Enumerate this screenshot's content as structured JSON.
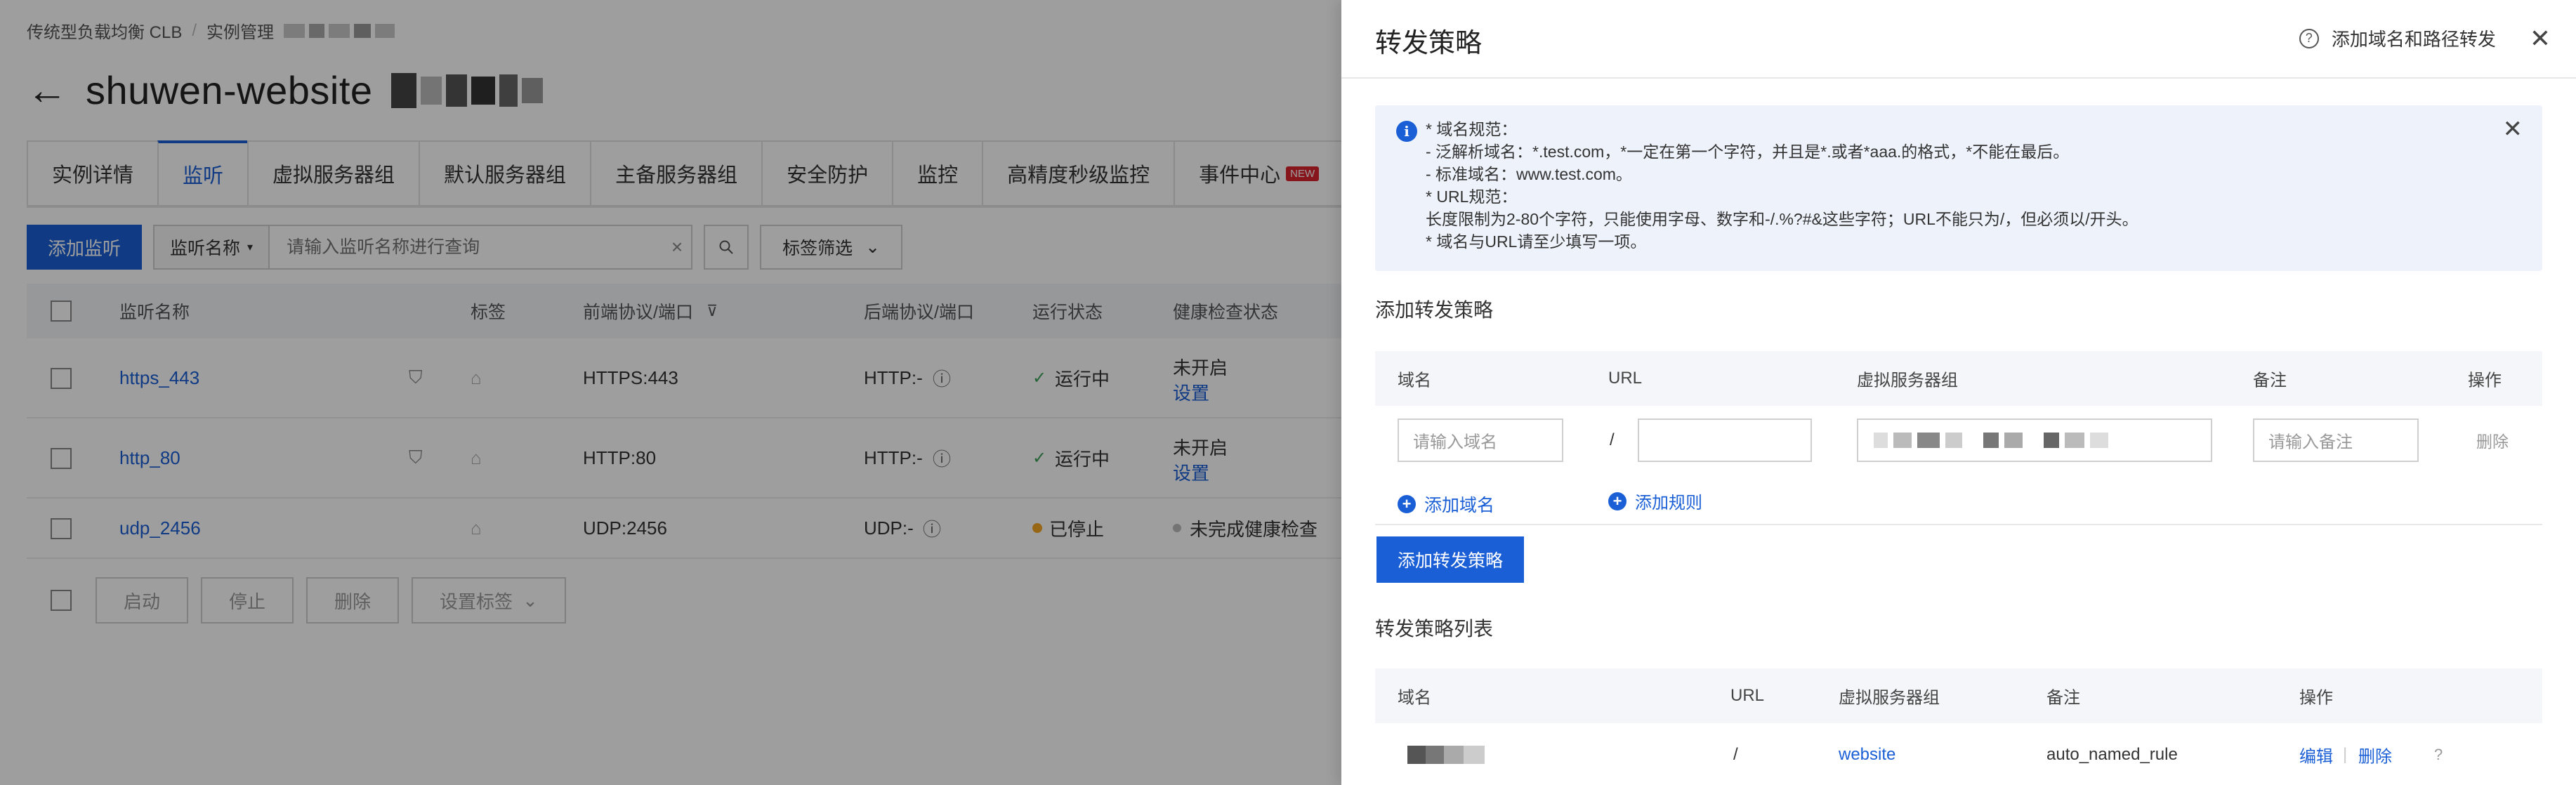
{
  "background": {
    "breadcrumb": [
      "传统型负载均衡 CLB",
      "实例管理"
    ],
    "title": "shuwen-website",
    "tabs": [
      "实例详情",
      "监听",
      "虚拟服务器组",
      "默认服务器组",
      "主备服务器组",
      "安全防护",
      "监控",
      "高精度秒级监控",
      "事件中心"
    ],
    "active_tab": "监听",
    "new_badge": "NEW",
    "toolbar": {
      "add_button": "添加监听",
      "search_select": "监听名称",
      "search_placeholder": "请输入监听名称进行查询",
      "tag_filter": "标签筛选"
    },
    "table": {
      "headers": [
        "监听名称",
        "标签",
        "前端协议/端口",
        "后端协议/端口",
        "运行状态",
        "健康检查状态"
      ],
      "rows": [
        {
          "name": "https_443",
          "frontend": "HTTPS:443",
          "backend": "HTTP:-",
          "status": "运行中",
          "health": "未开启",
          "health_link": "设置"
        },
        {
          "name": "http_80",
          "frontend": "HTTP:80",
          "backend": "HTTP:-",
          "status": "运行中",
          "health": "未开启",
          "health_link": "设置"
        },
        {
          "name": "udp_2456",
          "frontend": "UDP:2456",
          "backend": "UDP:-",
          "status": "已停止",
          "health": "未完成健康检查",
          "health_link": ""
        }
      ]
    },
    "bulk_actions": [
      "启动",
      "停止",
      "删除",
      "设置标签"
    ]
  },
  "drawer": {
    "title": "转发策略",
    "help_link": "添加域名和路径转发",
    "notice": [
      "* 域名规范：",
      "- 泛解析域名：*.test.com，*一定在第一个字符，并且是*.或者*aaa.的格式，*不能在最后。",
      "- 标准域名：www.test.com。",
      "* URL规范：",
      "长度限制为2-80个字符，只能使用字母、数字和-/.%?#&这些字符；URL不能只为/，但必须以/开头。",
      "* 域名与URL请至少填写一项。"
    ],
    "add_section_title": "添加转发策略",
    "form": {
      "headers": [
        "域名",
        "URL",
        "虚拟服务器组",
        "备注",
        "操作"
      ],
      "domain_placeholder": "请输入域名",
      "url_prefix": "/",
      "url_value": "",
      "remark_placeholder": "请输入备注",
      "delete_label": "删除",
      "add_domain": "添加域名",
      "add_rule": "添加规则"
    },
    "add_policy_button": "添加转发策略",
    "list_section_title": "转发策略列表",
    "list": {
      "headers": [
        "域名",
        "URL",
        "虚拟服务器组",
        "备注",
        "操作"
      ],
      "rows": [
        {
          "url": "/",
          "server_group": "website",
          "remark": "auto_named_rule",
          "edit": "编辑",
          "delete": "删除"
        }
      ]
    }
  }
}
